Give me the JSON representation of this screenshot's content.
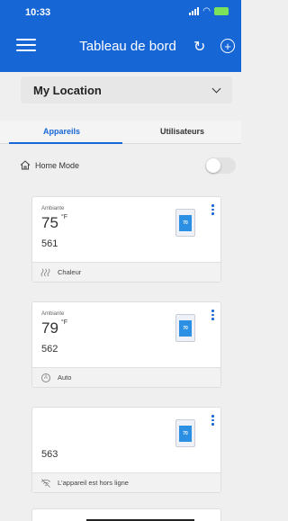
{
  "status_bar": {
    "time": "10:33"
  },
  "header": {
    "title": "Tableau de bord"
  },
  "location": {
    "name": "My Location"
  },
  "tabs": [
    {
      "label": "Appareils",
      "active": true
    },
    {
      "label": "Utilisateurs",
      "active": false
    }
  ],
  "home_mode": {
    "label": "Home Mode",
    "enabled": false
  },
  "devices": [
    {
      "ambient_label": "Ambiante",
      "temperature": "75",
      "unit": "°F",
      "id": "561",
      "thermostat_display": "70",
      "footer_icon": "heat-icon",
      "footer_label": "Chaleur"
    },
    {
      "ambient_label": "Ambiante",
      "temperature": "79",
      "unit": "°F",
      "id": "562",
      "thermostat_display": "70",
      "footer_icon": "auto-mode-icon",
      "footer_label": "Auto",
      "footer_icon_letter": "A"
    },
    {
      "id": "563",
      "thermostat_display": "70",
      "footer_icon": "offline-icon",
      "footer_label": "L'appareil est hors ligne"
    }
  ],
  "colors": {
    "brand_blue": "#1666d6",
    "accent_green": "#7be25c"
  }
}
